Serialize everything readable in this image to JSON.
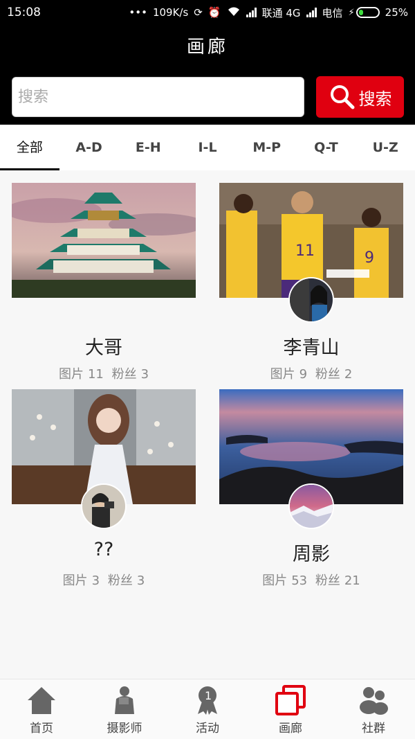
{
  "status_bar": {
    "time": "15:08",
    "dots": "•••",
    "speed": "109K/s",
    "carrier1": "联通 4G",
    "carrier2": "电信",
    "battery": "25%"
  },
  "header": {
    "title": "画廊"
  },
  "search": {
    "placeholder": "搜索",
    "button_label": "搜索",
    "accent": "#e00010"
  },
  "tabs": [
    {
      "label": "全部",
      "active": true
    },
    {
      "label": "A-D"
    },
    {
      "label": "E-H"
    },
    {
      "label": "I-L"
    },
    {
      "label": "M-P"
    },
    {
      "label": "Q-T"
    },
    {
      "label": "U-Z"
    }
  ],
  "cards": [
    {
      "name": "大哥",
      "photos_label": "图片",
      "photos": "11",
      "fans_label": "粉丝",
      "fans": "3",
      "image": "castle-photo",
      "has_avatar": false
    },
    {
      "name": "李青山",
      "photos_label": "图片",
      "photos": "9",
      "fans_label": "粉丝",
      "fans": "2",
      "image": "basketball-photo",
      "has_avatar": true
    },
    {
      "name": "??",
      "photos_label": "图片",
      "photos": "3",
      "fans_label": "粉丝",
      "fans": "3",
      "image": "woman-flowers-photo",
      "has_avatar": true
    },
    {
      "name": "周影",
      "photos_label": "图片",
      "photos": "53",
      "fans_label": "粉丝",
      "fans": "21",
      "image": "seascape-photo",
      "has_avatar": true
    }
  ],
  "bottom_nav": [
    {
      "label": "首页",
      "icon": "home-icon"
    },
    {
      "label": "摄影师",
      "icon": "photographer-icon"
    },
    {
      "label": "活动",
      "icon": "award-icon"
    },
    {
      "label": "画廊",
      "icon": "gallery-icon",
      "active": true
    },
    {
      "label": "社群",
      "icon": "community-icon"
    }
  ]
}
